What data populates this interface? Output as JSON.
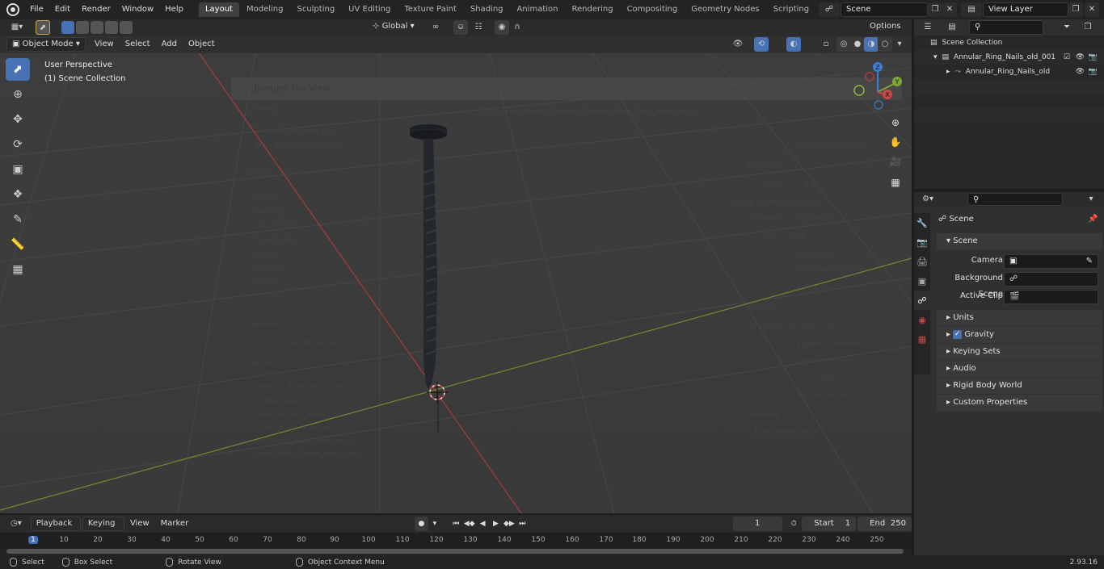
{
  "menubar": {
    "items": [
      "File",
      "Edit",
      "Render",
      "Window",
      "Help"
    ],
    "workspaces": [
      "Layout",
      "Modeling",
      "Sculpting",
      "UV Editing",
      "Texture Paint",
      "Shading",
      "Animation",
      "Rendering",
      "Compositing",
      "Geometry Nodes",
      "Scripting"
    ],
    "active_workspace": "Layout",
    "scene_name": "Scene",
    "view_layer": "View Layer"
  },
  "toolbar": {
    "transform_orientation": "Global",
    "options_label": "Options"
  },
  "viewport_header": {
    "mode": "Object Mode",
    "menus": [
      "View",
      "Select",
      "Add",
      "Object"
    ]
  },
  "viewport": {
    "perspective_label": "User Perspective",
    "collection_label": "(1) Scene Collection",
    "gizmo": {
      "z": "Z",
      "y": "Y",
      "x": "X"
    }
  },
  "ghost_dialog": {
    "title": "Blender File View",
    "path": "C:\\Users\\Sergey\\Desktop\\Annular_Ring_Nails_max_vray\\",
    "volumes_header": "Volumes",
    "volumes": [
      "Локальный диск (C:)",
      "DVD RW дисковод (E:)"
    ],
    "system_header": "System",
    "system": [
      "Home",
      "Desktop",
      "Documents",
      "Downloads",
      "Music",
      "Pictures",
      "Videos",
      "Fonts"
    ],
    "favorites_header": "Favorites",
    "add_bookmark": "Add Bookmark",
    "recent_header": "Recent",
    "recent": [
      "Annular_Ring_Nails_max",
      "BLEND Scripts",
      "Annular_Ring_Nails_OLD",
      "Cross_Nails_max_vray",
      "Hardened_Nails_max_vray",
      "Steel_Nails_Screw_max_vray"
    ],
    "right_labels": [
      "Custom Properties",
      "Transform",
      "Scale",
      "1.00",
      "Apply Scalings",
      "All Local",
      "Forward",
      "-Z Forward",
      "Up",
      "Y Up",
      "Apply Unit",
      "Use Space Transform",
      "Apply Transform",
      "Geometry",
      "Smoothing",
      "Normals Only",
      "Export Subdivision S",
      "Apply Modifiers",
      "Loose Edges",
      "Tangent Space",
      "Armature",
      "Bake Animation"
    ]
  },
  "outliner": {
    "rows": [
      {
        "label": "Scene Collection"
      },
      {
        "label": "Annular_Ring_Nails_old_001"
      },
      {
        "label": "Annular_Ring_Nails_old"
      }
    ]
  },
  "properties": {
    "context_label": "Scene",
    "panel_title": "Scene",
    "fields": [
      {
        "label": "Camera"
      },
      {
        "label": "Background Scene"
      },
      {
        "label": "Active Clip"
      }
    ],
    "sections": [
      "Units",
      "Gravity",
      "Keying Sets",
      "Audio",
      "Rigid Body World",
      "Custom Properties"
    ]
  },
  "timeline": {
    "menus": [
      "Playback",
      "Keying",
      "View",
      "Marker"
    ],
    "current_frame": "1",
    "start_label": "Start",
    "start": "1",
    "end_label": "End",
    "end": "250",
    "ticks": [
      "1",
      "10",
      "20",
      "30",
      "40",
      "50",
      "60",
      "70",
      "80",
      "90",
      "100",
      "110",
      "120",
      "130",
      "140",
      "150",
      "160",
      "170",
      "180",
      "190",
      "200",
      "210",
      "220",
      "230",
      "240",
      "250"
    ]
  },
  "statusbar": {
    "select": "Select",
    "box_select": "Box Select",
    "rotate_view": "Rotate View",
    "context_menu": "Object Context Menu",
    "version": "2.93.16"
  },
  "colors": {
    "accent": "#4772b3",
    "x_axis": "#c84848",
    "y_axis": "#7fa536",
    "z_axis": "#3b7dd8"
  }
}
